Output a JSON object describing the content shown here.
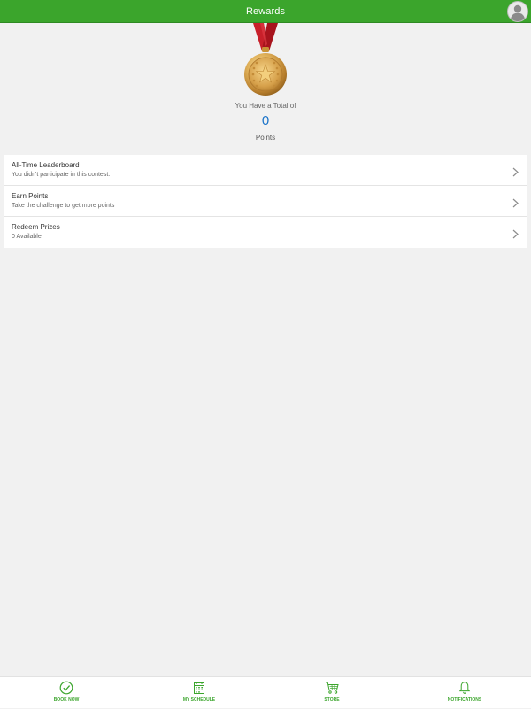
{
  "header": {
    "title": "Rewards",
    "avatar_icon": "user-avatar-icon"
  },
  "summary": {
    "total_label": "You Have a Total of",
    "points_value": "0",
    "points_label": "Points",
    "medal_icon": "gold-medal-icon"
  },
  "list": {
    "items": [
      {
        "title": "All-Time Leaderboard",
        "subtitle": "You didn't participate in this contest."
      },
      {
        "title": "Earn Points",
        "subtitle": "Take the challenge to get more points"
      },
      {
        "title": "Redeem Prizes",
        "subtitle": "0 Available"
      }
    ]
  },
  "tabbar": {
    "tabs": [
      {
        "label": "BOOK NOW",
        "icon": "check-circle-icon"
      },
      {
        "label": "MY SCHEDULE",
        "icon": "calendar-icon"
      },
      {
        "label": "STORE",
        "icon": "cart-icon"
      },
      {
        "label": "NOTIFICATIONS",
        "icon": "bell-icon"
      }
    ]
  },
  "colors": {
    "header_bg": "#3ba52c",
    "accent_green": "#3ba52c",
    "points_blue": "#1a73c9",
    "page_bg": "#f1f1f1"
  }
}
